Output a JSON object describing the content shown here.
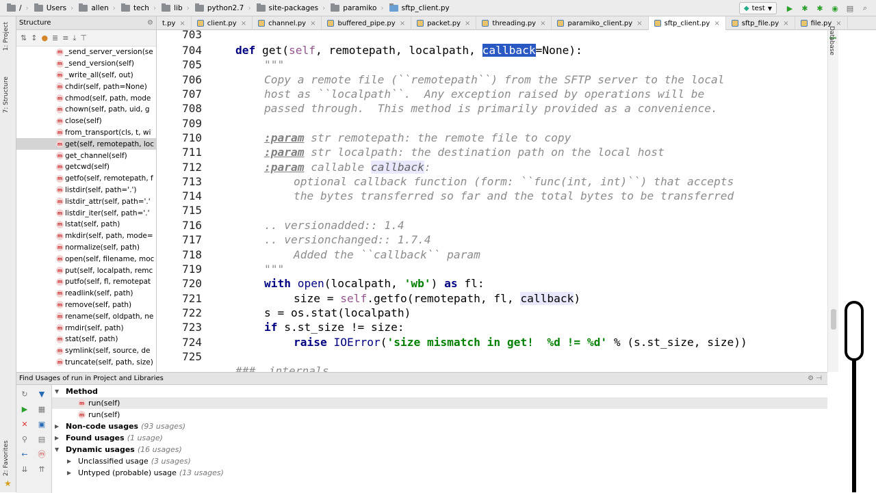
{
  "breadcrumbs": [
    "/",
    "Users",
    "allen",
    "tech",
    "lib",
    "python2.7",
    "site-packages",
    "paramiko",
    "sftp_client.py"
  ],
  "run_config": "test",
  "left_strip": {
    "project": "1: Project",
    "structure": "7: Structure",
    "favorites": "2: Favorites"
  },
  "structure": {
    "title": "Structure",
    "items": [
      {
        "label": "_send_server_version(se",
        "selected": false
      },
      {
        "label": "_send_version(self)",
        "selected": false
      },
      {
        "label": "_write_all(self, out)",
        "selected": false
      },
      {
        "label": "chdir(self, path=None)",
        "selected": false
      },
      {
        "label": "chmod(self, path, mode",
        "selected": false
      },
      {
        "label": "chown(self, path, uid, g",
        "selected": false
      },
      {
        "label": "close(self)",
        "selected": false
      },
      {
        "label": "from_transport(cls, t, wi",
        "selected": false
      },
      {
        "label": "get(self, remotepath, loc",
        "selected": true
      },
      {
        "label": "get_channel(self)",
        "selected": false
      },
      {
        "label": "getcwd(self)",
        "selected": false
      },
      {
        "label": "getfo(self, remotepath, f",
        "selected": false
      },
      {
        "label": "listdir(self, path='.')",
        "selected": false
      },
      {
        "label": "listdir_attr(self, path='.'",
        "selected": false
      },
      {
        "label": "listdir_iter(self, path='.'",
        "selected": false
      },
      {
        "label": "lstat(self, path)",
        "selected": false
      },
      {
        "label": "mkdir(self, path, mode=",
        "selected": false
      },
      {
        "label": "normalize(self, path)",
        "selected": false
      },
      {
        "label": "open(self, filename, moc",
        "selected": false
      },
      {
        "label": "put(self, localpath, remc",
        "selected": false
      },
      {
        "label": "putfo(self, fl, remotepat",
        "selected": false
      },
      {
        "label": "readlink(self, path)",
        "selected": false
      },
      {
        "label": "remove(self, path)",
        "selected": false
      },
      {
        "label": "rename(self, oldpath, ne",
        "selected": false
      },
      {
        "label": "rmdir(self, path)",
        "selected": false
      },
      {
        "label": "stat(self, path)",
        "selected": false
      },
      {
        "label": "symlink(self, source, de",
        "selected": false
      },
      {
        "label": "truncate(self, path, size)",
        "selected": false
      }
    ]
  },
  "tabs": [
    {
      "label": "t.py",
      "active": false
    },
    {
      "label": "client.py",
      "active": false
    },
    {
      "label": "channel.py",
      "active": false
    },
    {
      "label": "buffered_pipe.py",
      "active": false
    },
    {
      "label": "packet.py",
      "active": false
    },
    {
      "label": "threading.py",
      "active": false
    },
    {
      "label": "paramiko_client.py",
      "active": false
    },
    {
      "label": "sftp_client.py",
      "active": true
    },
    {
      "label": "sftp_file.py",
      "active": false
    },
    {
      "label": "file.py",
      "active": false
    }
  ],
  "editor": {
    "line_numbers": [
      "703",
      "704",
      "705",
      "706",
      "707",
      "708",
      "709",
      "710",
      "711",
      "712",
      "713",
      "714",
      "715",
      "716",
      "717",
      "718",
      "719",
      "720",
      "721",
      "722",
      "723",
      "724",
      "725"
    ],
    "code": {
      "l704a": "def ",
      "l704b": "get",
      "l704c": "(",
      "l704d": "self",
      "l704e": ", remotepath, localpath, ",
      "l704f": "callback",
      "l704g": "=None):",
      "l705": "\"\"\"",
      "l706": "Copy a remote file (``remotepath``) from the SFTP server to the local",
      "l707": "host as ``localpath``.  Any exception raised by operations will be",
      "l708": "passed through.  This method is primarily provided as a convenience.",
      "l710a": ":param",
      "l710b": " str remotepath: the remote file to copy",
      "l711a": ":param",
      "l711b": " str localpath: the destination path on the local host",
      "l712a": ":param",
      "l712b": " callable ",
      "l712c": "callback",
      ":l712d": ":",
      "l712d": ":",
      "l713": "optional callback function (form: ``func(int, int)``) that accepts",
      "l714": "the bytes transferred so far and the total bytes to be transferred",
      "l716": ".. versionadded:: 1.4",
      "l717": ".. versionchanged:: 1.7.4",
      "l718": "Added the ``callback`` param",
      "l719": "\"\"\"",
      "l720a": "with ",
      "l720b": "open",
      "l720c": "(localpath, ",
      "l720d": "'wb'",
      "l720e": ") ",
      "l720f": "as ",
      "l720g": "fl:",
      "l721a": "size = ",
      "l721b": "self",
      "l721c": ".getfo(remotepath, fl, ",
      "l721d": "callback",
      "l721e": ")",
      "l722": "s = os.stat(localpath)",
      "l723a": "if ",
      "l723b": "s.st_size != size:",
      "l724a": "raise ",
      "l724b": "IOError",
      "l724c": "(",
      "l724d": "'size mismatch in get!  %d != %d'",
      "l724e": " % (s.st_size, size))",
      "l726": "###  internals"
    }
  },
  "find_usages": {
    "title": "Find Usages of run in Project and Libraries",
    "method_label": "Method",
    "run1": "run(self)",
    "run2": "run(self)",
    "noncode": "Non-code usages",
    "noncode_count": "(93 usages)",
    "found": "Found usages",
    "found_count": "(1 usage)",
    "dynamic": "Dynamic usages",
    "dynamic_count": "(16 usages)",
    "unclassified": "Unclassified usage",
    "unclassified_count": "(3 usages)",
    "untyped": "Untyped (probable) usage",
    "untyped_count": "(13 usages)"
  },
  "right_strip": {
    "database": "Database"
  }
}
